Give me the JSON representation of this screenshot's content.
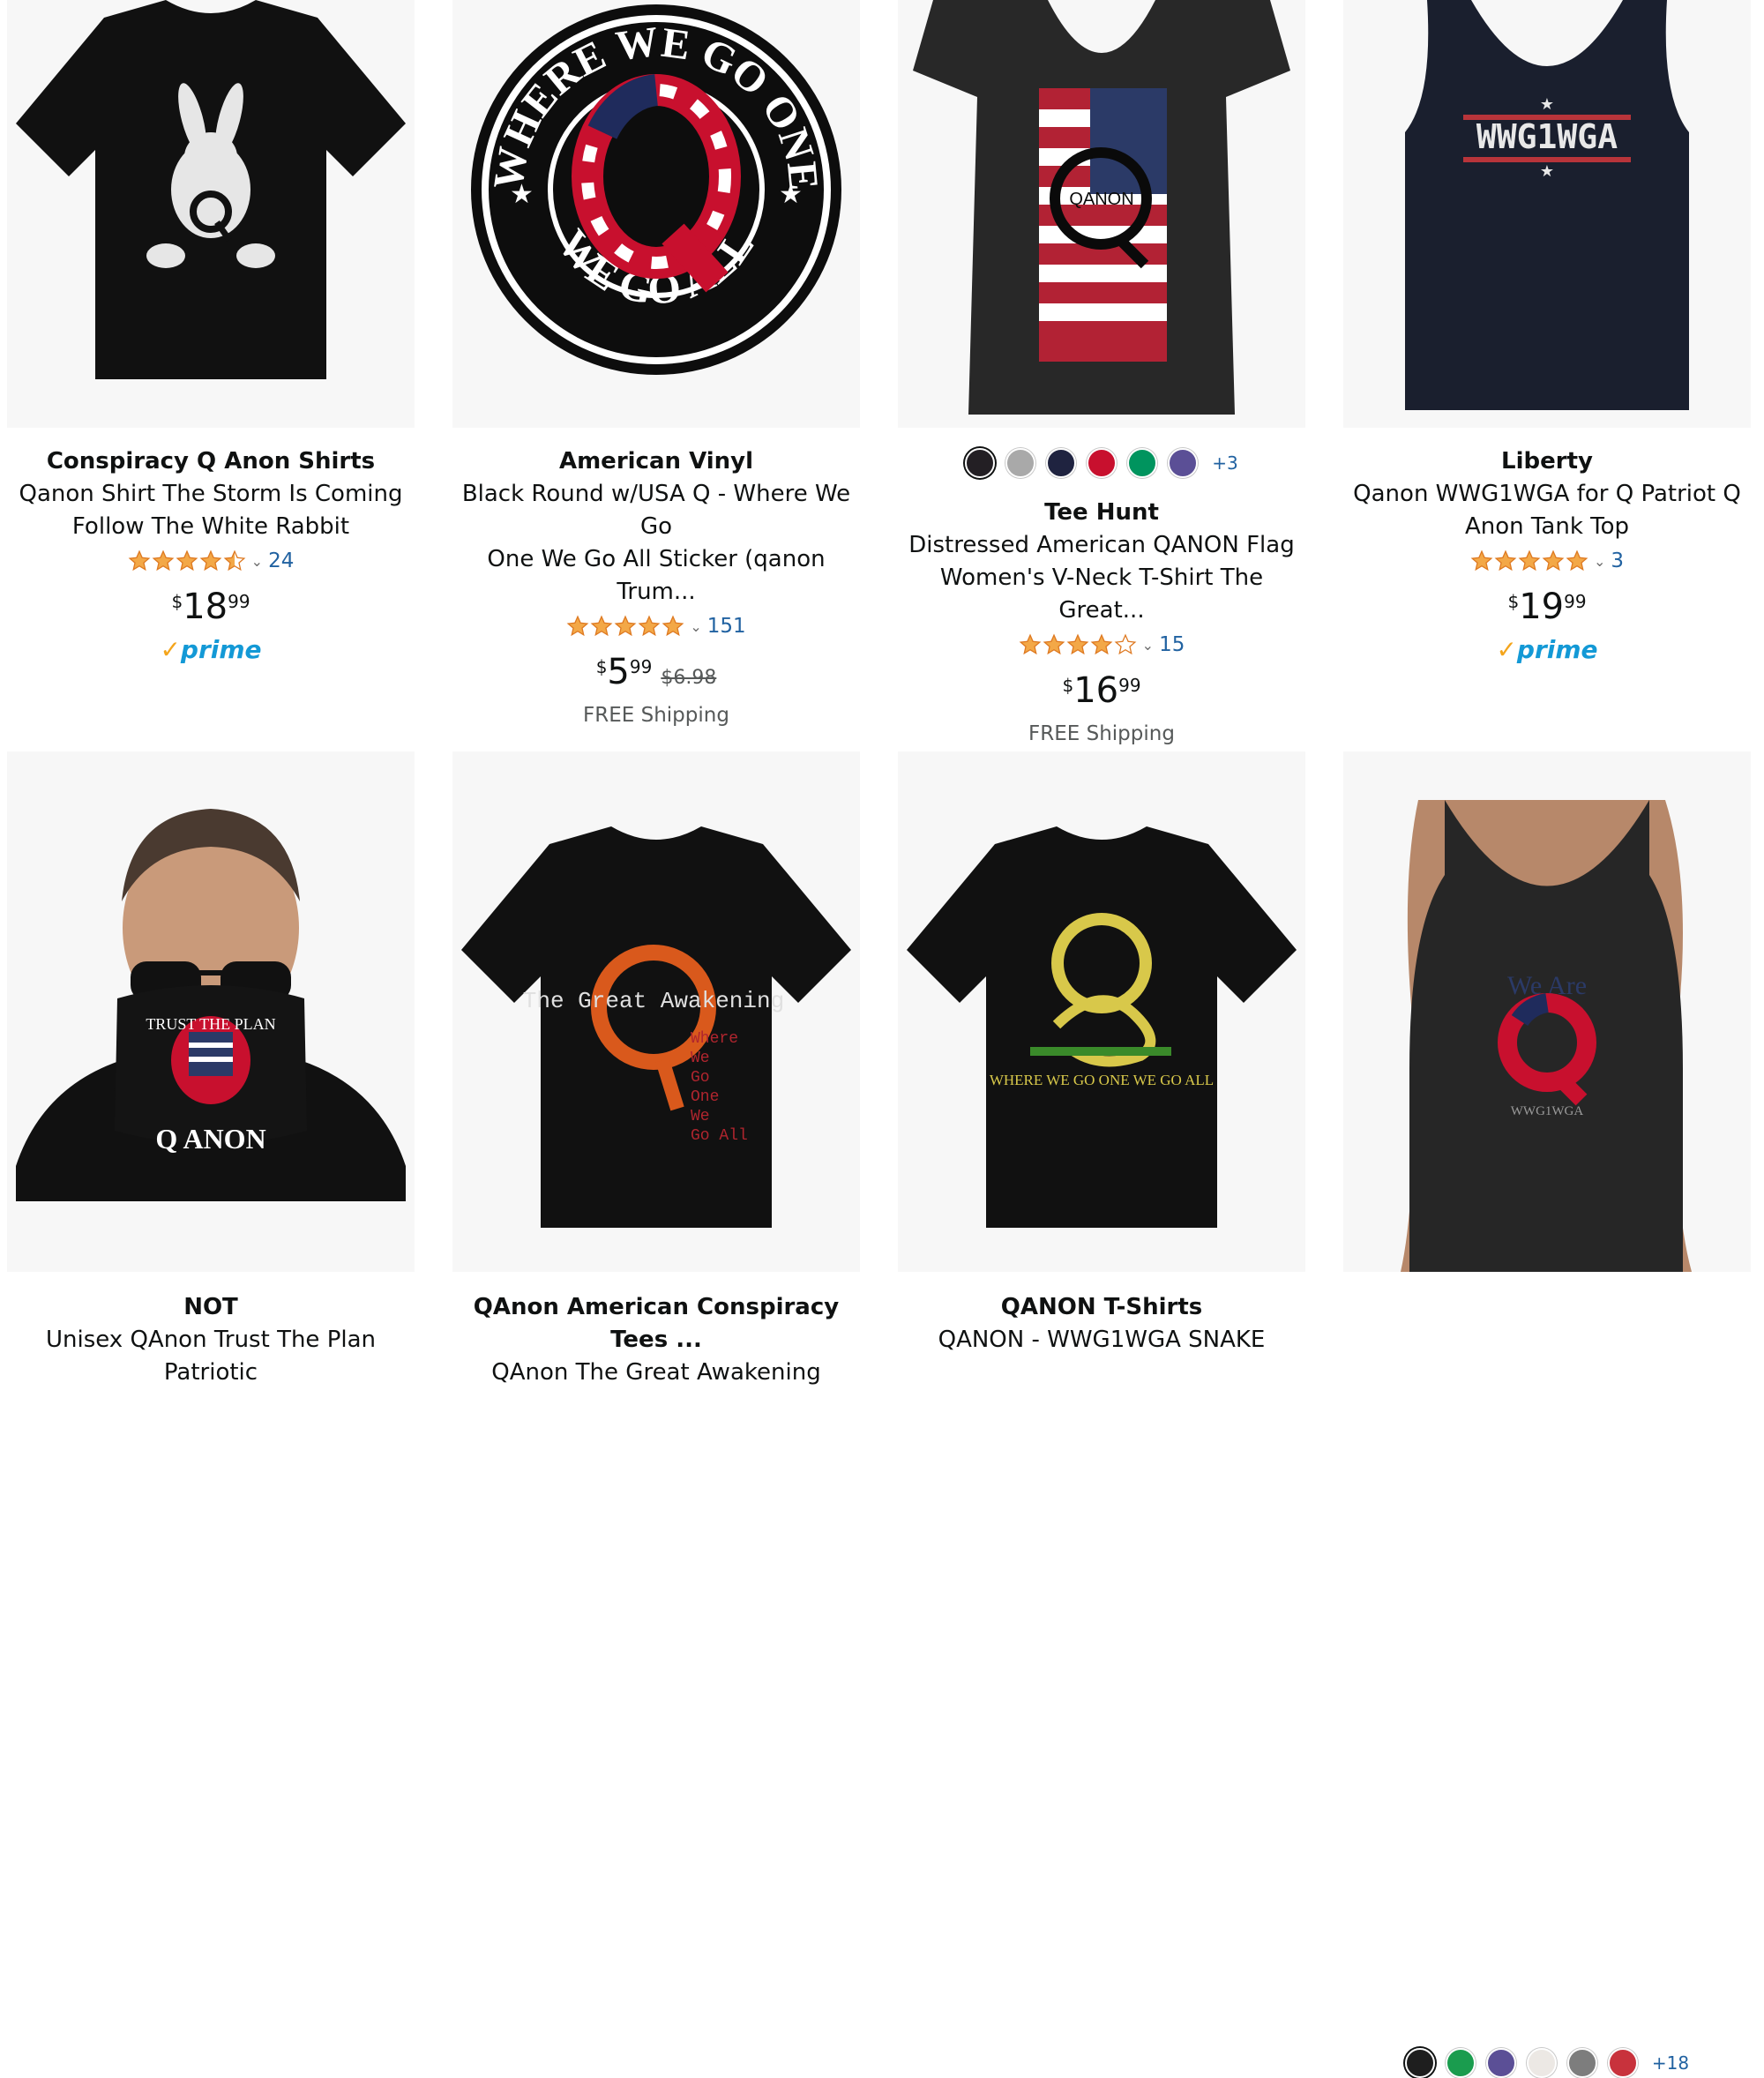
{
  "products": [
    {
      "brand": "Conspiracy Q Anon Shirts",
      "title_line1": "Qanon Shirt The Storm Is Coming",
      "title_line2": "Follow The White Rabbit",
      "rating": 4.5,
      "review_count": "24",
      "price_symbol": "$",
      "price_whole": "18",
      "price_fraction": "99",
      "prime_label": "prime",
      "image_icon": "tshirt-rabbit-q-icon"
    },
    {
      "brand": "American Vinyl",
      "title_line1": "Black Round w/USA Q - Where We Go",
      "title_line2": "One We Go All Sticker (qanon Trum...",
      "rating": 5,
      "review_count": "151",
      "price_symbol": "$",
      "price_whole": "5",
      "price_fraction": "99",
      "price_old": "$6.98",
      "shipping": "FREE Shipping",
      "image_text_top": "WHERE WE GO ONE",
      "image_text_bottom": "WE GO ALL",
      "image_icon": "round-q-sticker-icon"
    },
    {
      "swatches": [
        "#231f24",
        "#a9a9a9",
        "#1f2340",
        "#c8102e",
        "#00945e",
        "#5b4f96"
      ],
      "swatches_more": "+3",
      "brand": "Tee Hunt",
      "title_line1": "Distressed American QANON Flag",
      "title_line2": "Women's V-Neck T-Shirt The Great...",
      "rating": 4,
      "review_count": "15",
      "price_symbol": "$",
      "price_whole": "16",
      "price_fraction": "99",
      "shipping": "FREE Shipping",
      "image_text": "QANON",
      "image_icon": "vneck-flag-q-icon"
    },
    {
      "brand": "Liberty",
      "title_line1": "Qanon WWG1WGA for Q Patriot Q",
      "title_line2": "Anon Tank Top",
      "rating": 5,
      "review_count": "3",
      "price_symbol": "$",
      "price_whole": "19",
      "price_fraction": "99",
      "prime_label": "prime",
      "image_text": "WWG1WGA",
      "image_icon": "tank-top-wwg1wga-icon"
    },
    {
      "brand": "NOT",
      "title_line1": "Unisex QAnon Trust The Plan Patriotic",
      "image_text_top": "TRUST THE PLAN",
      "image_text_bottom": "Q ANON",
      "image_icon": "neck-gaiter-man-icon"
    },
    {
      "brand": "QAnon American Conspiracy Tees ...",
      "title_line1": "QAnon The Great Awakening",
      "image_text_main": "The Great Awakening",
      "image_text_side": [
        "Where",
        "We",
        "Go",
        "One",
        "We",
        "Go All"
      ],
      "image_icon": "tshirt-fire-q-icon"
    },
    {
      "brand": "QANON T-Shirts",
      "title_line1": "QANON - WWG1WGA SNAKE",
      "image_text": "WHERE WE GO ONE WE GO ALL",
      "image_icon": "tshirt-snake-q-icon"
    },
    {
      "image_text_top": "We Are",
      "image_text_bottom": "WWG1WGA",
      "image_icon": "woman-tank-top-q-icon",
      "swatches": [
        "#1e1e1e",
        "#1a9c4e",
        "#5b4f96",
        "#ece8e4",
        "#7d7d7d",
        "#c8323c"
      ],
      "swatches_more": "+18"
    }
  ]
}
